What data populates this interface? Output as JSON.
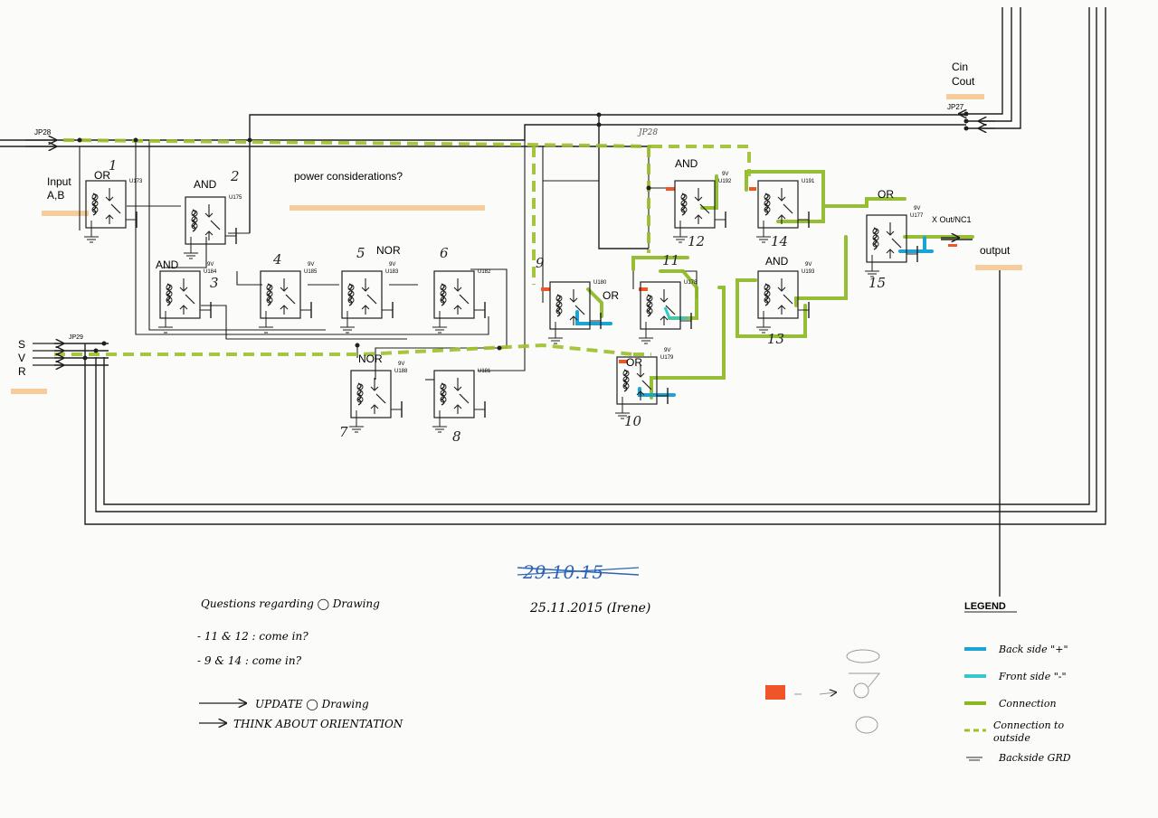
{
  "connectors": {
    "jp28_left": "JP28",
    "jp28_mid": "JP28",
    "jp27": "JP27",
    "jp29": "JP29",
    "cin": "Cin",
    "cout": "Cout",
    "input_ab": "Input\nA,B",
    "svr": [
      "S",
      "V",
      "R"
    ],
    "output": "output",
    "xout": "X Out/NC1"
  },
  "note_power": "power considerations?",
  "relays": [
    {
      "id": "r1",
      "gate": "OR",
      "num": "1",
      "ref": "U173",
      "supply": ""
    },
    {
      "id": "r2",
      "gate": "AND",
      "num": "2",
      "ref": "U175",
      "supply": ""
    },
    {
      "id": "r3",
      "gate": "AND",
      "num": "3",
      "ref": "U184",
      "supply": "9V"
    },
    {
      "id": "r4",
      "gate": "",
      "num": "4",
      "ref": "U185",
      "supply": "9V"
    },
    {
      "id": "r5",
      "gate": "NOR",
      "num": "5",
      "ref": "U183",
      "supply": "9V"
    },
    {
      "id": "r6",
      "gate": "",
      "num": "6",
      "ref": "U182",
      "supply": ""
    },
    {
      "id": "r7",
      "gate": "NOR",
      "num": "7",
      "ref": "U188",
      "supply": "9V"
    },
    {
      "id": "r8",
      "gate": "",
      "num": "8",
      "ref": "U181",
      "supply": ""
    },
    {
      "id": "r9",
      "gate": "OR",
      "num": "9",
      "ref": "U180",
      "supply": ""
    },
    {
      "id": "r10",
      "gate": "OR",
      "num": "10",
      "ref": "U179",
      "supply": "9V"
    },
    {
      "id": "r11",
      "gate": "",
      "num": "11",
      "ref": "U178",
      "supply": ""
    },
    {
      "id": "r12",
      "gate": "AND",
      "num": "12",
      "ref": "U192",
      "supply": "9V"
    },
    {
      "id": "r13",
      "gate": "AND",
      "num": "13",
      "ref": "U193",
      "supply": "9V"
    },
    {
      "id": "r14",
      "gate": "",
      "num": "14",
      "ref": "U191",
      "supply": ""
    },
    {
      "id": "r15",
      "gate": "OR",
      "num": "15",
      "ref": "U177",
      "supply": "9V"
    }
  ],
  "dates": {
    "old": "29.10.15",
    "new": "25.11.2015 (Irene)"
  },
  "notes": [
    "Questions regarding ◯ Drawing",
    "- 11 & 12 : come in?",
    "- 9 & 14 : come in?",
    "UPDATE ◯ Drawing",
    "THINK ABOUT ORIENTATION"
  ],
  "legend": {
    "title": "LEGEND",
    "items": [
      {
        "label": "Back side \"+\"",
        "color": "#1aa3d3",
        "style": "solid"
      },
      {
        "label": "Front side \"-\"",
        "color": "#35c7c9",
        "style": "solid"
      },
      {
        "label": "Connection",
        "color": "#8cb81f",
        "style": "solid"
      },
      {
        "label": "Connection to outside",
        "color": "#9cc02b",
        "style": "dashed"
      },
      {
        "label": "Backside GRD",
        "color": "#555555",
        "style": "ground"
      }
    ]
  },
  "colors": {
    "highlight": "#f4c48a",
    "red_mark": "#f0552a",
    "wire": "#1f1f1f"
  }
}
